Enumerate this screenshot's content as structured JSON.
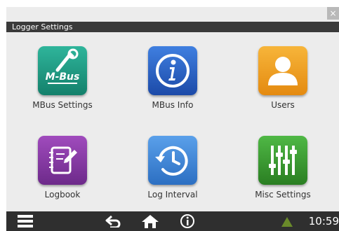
{
  "window": {
    "title": "Logger Settings",
    "close_glyph": "×"
  },
  "tiles": [
    {
      "label": "MBus Settings",
      "icon": "mbus-wrench-icon",
      "color": "#1a9a82",
      "icon_text": "M-Bus"
    },
    {
      "label": "MBus Info",
      "icon": "info-icon",
      "color": "#2a62c4"
    },
    {
      "label": "Users",
      "icon": "user-icon",
      "color": "#f2a21e"
    },
    {
      "label": "Logbook",
      "icon": "notebook-pen-icon",
      "color": "#8b3ea6"
    },
    {
      "label": "Log Interval",
      "icon": "clock-history-icon",
      "color": "#3b86d8"
    },
    {
      "label": "Misc Settings",
      "icon": "sliders-icon",
      "color": "#3a9d2f"
    }
  ],
  "bottombar": {
    "menu_icon": "menu-icon",
    "back_icon": "back-arrow-icon",
    "home_icon": "home-icon",
    "info_icon": "info-circle-icon",
    "warning_icon": "warning-icon",
    "warning_color": "#6a8a2a",
    "time": "10:59"
  }
}
